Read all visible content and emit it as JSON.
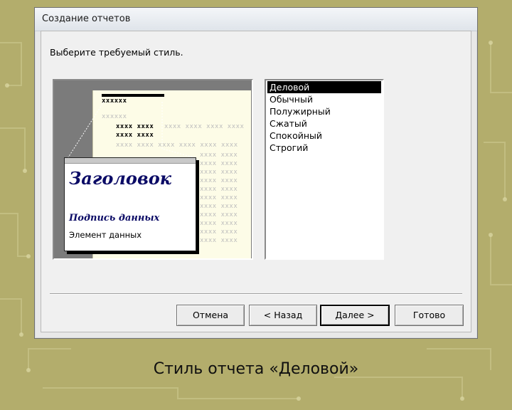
{
  "window": {
    "title": "Создание отчетов"
  },
  "prompt": "Выберите требуемый стиль.",
  "preview": {
    "heading": "Заголовок",
    "data_caption": "Подпись данных",
    "data_element": "Элемент данных",
    "placeholder_bold": "xxxxxx",
    "placeholder_light": "xxxx xxxx xxxx xxxx"
  },
  "styles": {
    "items": [
      "Деловой",
      "Обычный",
      "Полужирный",
      "Сжатый",
      "Спокойный",
      "Строгий"
    ],
    "selected": "Деловой"
  },
  "buttons": {
    "cancel": "Отмена",
    "back": "< Назад",
    "next": "Далее >",
    "finish": "Готово"
  },
  "caption": "Стиль отчета «Деловой»",
  "colors": {
    "background": "#b3ad6c",
    "heading_text": "#0b0b66",
    "preview_page": "#fdfce7",
    "selection": "#000000"
  }
}
